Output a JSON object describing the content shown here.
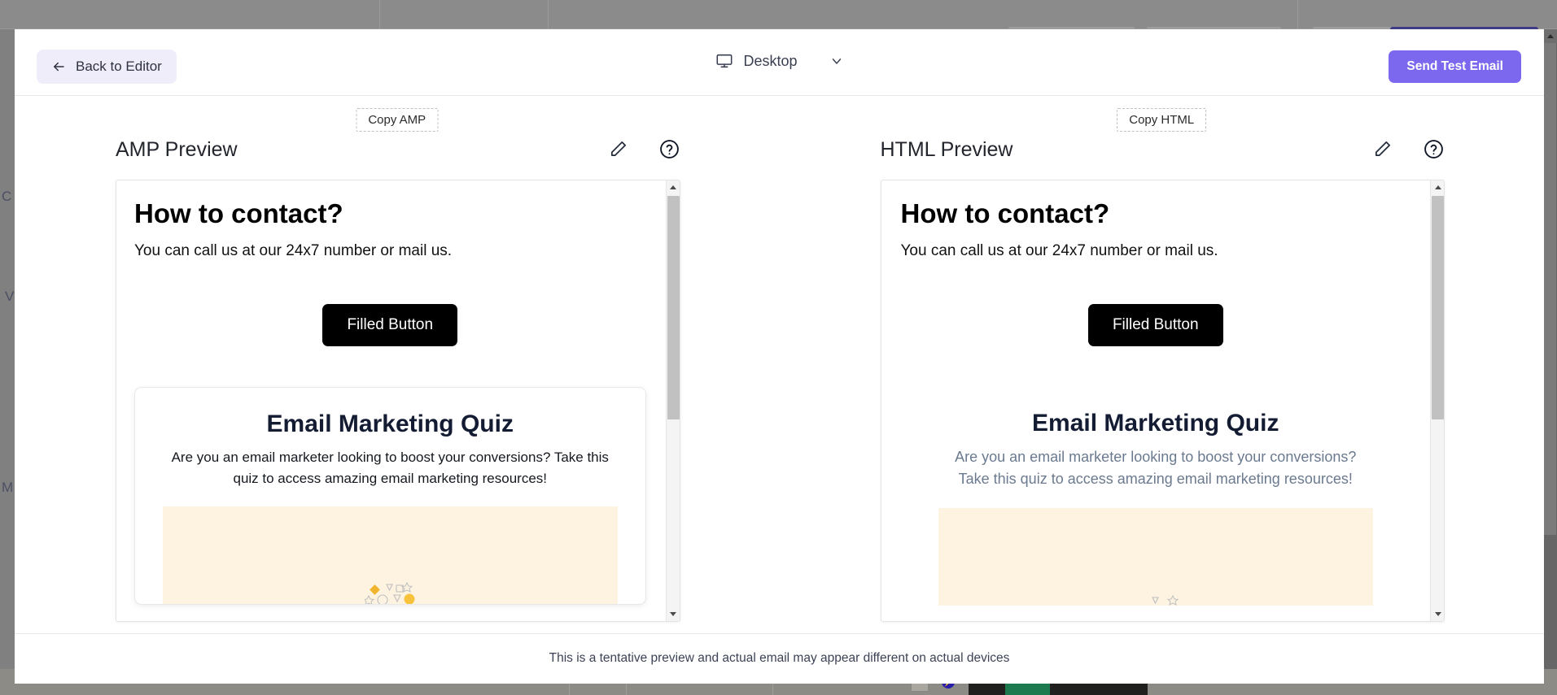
{
  "header": {
    "back_label": "Back to Editor",
    "back_icon": "arrow-left-icon",
    "device_label": "Desktop",
    "device_icon": "desktop-monitor-icon",
    "device_chevron_icon": "chevron-down-icon",
    "send_label": "Send Test Email",
    "accent_color": "#7b68ee",
    "back_btn_bg": "#f0edfb"
  },
  "panes": [
    {
      "id": "amp",
      "copy_label": "Copy AMP",
      "title": "AMP Preview",
      "edit_icon": "pencil-edit-icon",
      "help_icon": "question-circle-icon",
      "email": {
        "heading": "How to contact?",
        "paragraph": "You can call us at our 24x7 number or mail us.",
        "button_label": "Filled Button",
        "button_bg": "#000000",
        "button_text_color": "#ffffff",
        "quiz_title": "Email Marketing Quiz",
        "quiz_subtitle": "Are you an email marketer looking to boost your conversions? Take this quiz to access amazing email marketing resources!",
        "quiz_subtitle_color": "#14181f",
        "banner_bg": "#fdf3e0"
      }
    },
    {
      "id": "html",
      "copy_label": "Copy HTML",
      "title": "HTML Preview",
      "edit_icon": "pencil-edit-icon",
      "help_icon": "question-circle-icon",
      "email": {
        "heading": "How to contact?",
        "paragraph": "You can call us at our 24x7 number or mail us.",
        "button_label": "Filled Button",
        "button_bg": "#000000",
        "button_text_color": "#ffffff",
        "quiz_title": "Email Marketing Quiz",
        "quiz_subtitle": "Are you an email marketer looking to boost your conversions? Take this quiz to access amazing email marketing resources!",
        "quiz_subtitle_color": "#6b7a8f",
        "banner_bg": "#fdf3e0"
      }
    }
  ],
  "footer": {
    "note": "This is a tentative preview and actual email may appear different on actual devices"
  },
  "background": {
    "letters": [
      "C",
      "V",
      "M"
    ]
  }
}
